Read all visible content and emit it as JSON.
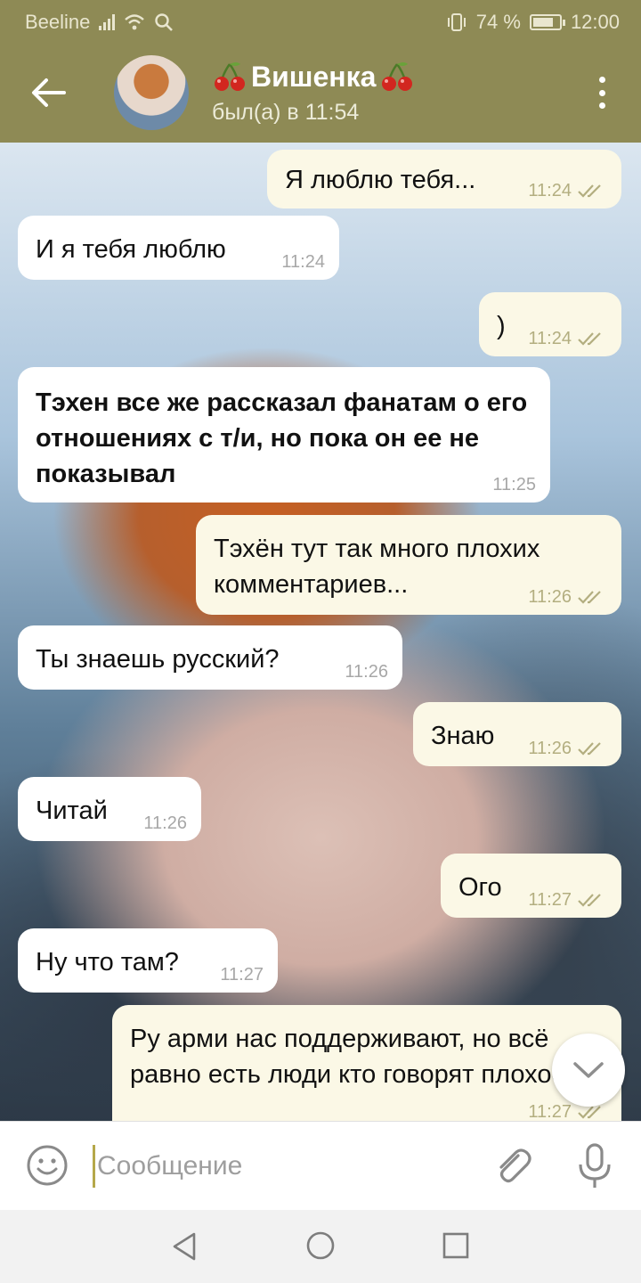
{
  "status": {
    "carrier": "Beeline",
    "battery": "74 %",
    "time": "12:00"
  },
  "header": {
    "name": "Вишенка",
    "last_seen": "был(а) в 11:54"
  },
  "messages": [
    {
      "dir": "out",
      "text": "Я люблю тебя...",
      "time": "11:24",
      "read": true
    },
    {
      "dir": "in",
      "text": "И я тебя люблю",
      "time": "11:24"
    },
    {
      "dir": "out",
      "text": ")",
      "time": "11:24",
      "read": true
    },
    {
      "dir": "in",
      "text": "Тэхен все же рассказал фанатам о его отношениях с т/и, но пока он ее не показывал",
      "time": "11:25",
      "bold": true
    },
    {
      "dir": "out",
      "text": "Тэхён тут так много плохих комментариев...",
      "time": "11:26",
      "read": true
    },
    {
      "dir": "in",
      "text": "Ты знаешь русский?",
      "time": "11:26"
    },
    {
      "dir": "out",
      "text": "Знаю",
      "time": "11:26",
      "read": true
    },
    {
      "dir": "in",
      "text": "Читай",
      "time": "11:26"
    },
    {
      "dir": "out",
      "text": "Ого",
      "time": "11:27",
      "read": true
    },
    {
      "dir": "in",
      "text": "Ну что там?",
      "time": "11:27"
    },
    {
      "dir": "out",
      "text": "Ру арми нас поддерживают, но всё равно есть люди кто говорят плохое",
      "time": "11:27",
      "read": true
    }
  ],
  "composer": {
    "placeholder": "Сообщение"
  },
  "colors": {
    "header": "#8e8a55",
    "outgoing_bubble": "#fbf8e6",
    "incoming_bubble": "#ffffff",
    "check": "#b3ae80"
  }
}
